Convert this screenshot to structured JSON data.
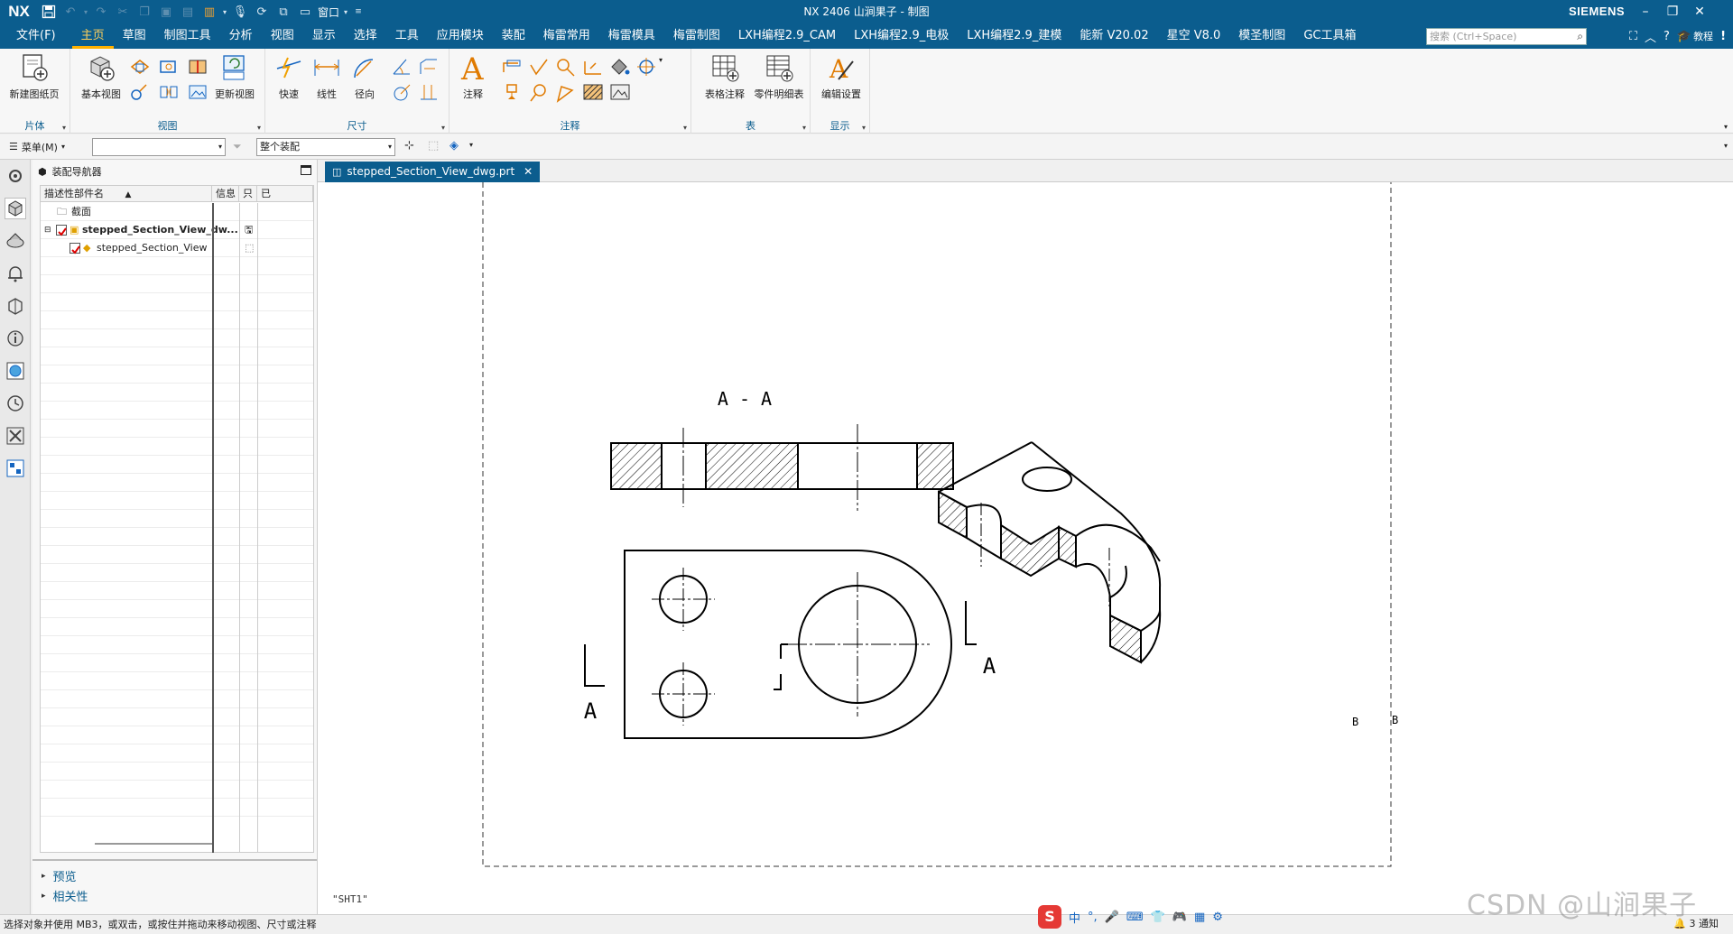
{
  "titlebar": {
    "logo": "NX",
    "window_label": "窗口",
    "title": "NX 2406 山涧果子 - 制图",
    "brand": "SIEMENS"
  },
  "menubar": {
    "items": [
      "文件(F)",
      "主页",
      "草图",
      "制图工具",
      "分析",
      "视图",
      "显示",
      "选择",
      "工具",
      "应用模块",
      "装配",
      "梅雷常用",
      "梅雷模具",
      "梅雷制图",
      "LXH编程2.9_CAM",
      "LXH编程2.9_电极",
      "LXH编程2.9_建模",
      "能新 V20.02",
      "星空 V8.0",
      "模圣制图",
      "GC工具箱"
    ],
    "active_index": 1,
    "search_placeholder": "搜索 (Ctrl+Space)",
    "tutorial": "教程"
  },
  "ribbon": {
    "groups": {
      "sheet": "片体",
      "view": "视图",
      "dimension": "尺寸",
      "annotation": "注释",
      "table": "表",
      "display": "显示"
    },
    "buttons": {
      "new_sheet": "新建图纸页",
      "base_view": "基本视图",
      "update_view": "更新视图",
      "rapid": "快速",
      "linear": "线性",
      "radial": "径向",
      "note": "注释",
      "table_note": "表格注释",
      "parts_list": "零件明细表",
      "edit_settings": "编辑设置"
    }
  },
  "toolbar2": {
    "menu_label": "菜单(M)",
    "filter_value": "",
    "scope_value": "整个装配"
  },
  "navigator": {
    "title": "装配导航器",
    "columns": [
      "描述性部件名",
      "信息",
      "只",
      "已"
    ],
    "rows": [
      {
        "label": "截面",
        "bold": false
      },
      {
        "label": "stepped_Section_View_dw...",
        "bold": true
      },
      {
        "label": "stepped_Section_View",
        "bold": false
      }
    ],
    "preview": "预览",
    "relations": "相关性"
  },
  "document": {
    "tab": "stepped_Section_View_dwg.prt",
    "sheet": "\"SHT1\"",
    "section_title": "A - A",
    "section_label_left": "A",
    "section_label_right": "A",
    "border_label_1": "B",
    "border_label_2": "B"
  },
  "statusbar": {
    "message": "选择对象并使用 MB3，或双击，或按住并拖动来移动视图、尺寸或注释",
    "notifications": "3 通知",
    "ime_lang": "中"
  },
  "watermark": "CSDN @山涧果子"
}
